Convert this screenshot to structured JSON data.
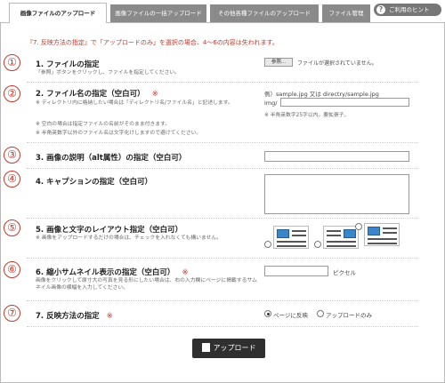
{
  "tabs": [
    {
      "label": "画像ファイルのアップロード",
      "active": true
    },
    {
      "label": "画像ファイルの一括アップロード",
      "active": false
    },
    {
      "label": "その他各種ファイルのアップロード",
      "active": false
    },
    {
      "label": "ファイル管理",
      "active": false
    }
  ],
  "hint_label": "ご利用のヒント",
  "notice": "『7. 反映方法の指定』で「アップロードのみ」を選択の場合、4〜6の内容は失われます。",
  "markers": [
    "①",
    "②",
    "③",
    "④",
    "⑤",
    "⑥",
    "⑦"
  ],
  "sections": {
    "s1": {
      "title": "1. ファイルの指定",
      "required": "※",
      "note": "「参照」ボタンをクリックし、ファイルを指定してください。",
      "browse_label": "参照...",
      "no_file": "ファイルが選択されていません。"
    },
    "s2": {
      "title": "2. ファイル名の指定（空白可）",
      "required": "※",
      "note1": "※ ディレクトリ内に格納したい場合は「ディレクトリ名/ファイル名」と記述します。",
      "note2": "※ 空白の場合は指定ファイルの名前がそのまま付きます。",
      "note3": "※ 半角英数字以外のファイル名は文字化けしますので避けてください。",
      "example": "例）sample.jpg 又は directry/sample.jpg",
      "prefix": "img/",
      "field_value": "",
      "hint": "※ 半角英数字25字以内。要拡張子。"
    },
    "s3": {
      "title": "3. 画像の説明（alt属性）の指定（空白可）",
      "field_value": ""
    },
    "s4": {
      "title": "4. キャプションの指定（空白可）",
      "field_value": ""
    },
    "s5": {
      "title": "5. 画像と文字のレイアウト指定（空白可）",
      "note": "※ 画像をアップロードするだけの場合は、チェックを入れなくても構いません。"
    },
    "s6": {
      "title": "6. 縮小サムネイル表示の指定（空白可）",
      "required": "※",
      "note": "画像をクリックして原寸大の写真を見る形にしたい場合は、右の入力欄にページに掲載するサムネイル画像の横幅を入力してください。",
      "field_value": "",
      "unit": "ピクセル"
    },
    "s7": {
      "title": "7. 反映方法の指定",
      "required": "※",
      "opt1": "ページに反映",
      "opt2": "アップロードのみ",
      "selected": "opt1"
    }
  },
  "upload_label": "アップロード"
}
